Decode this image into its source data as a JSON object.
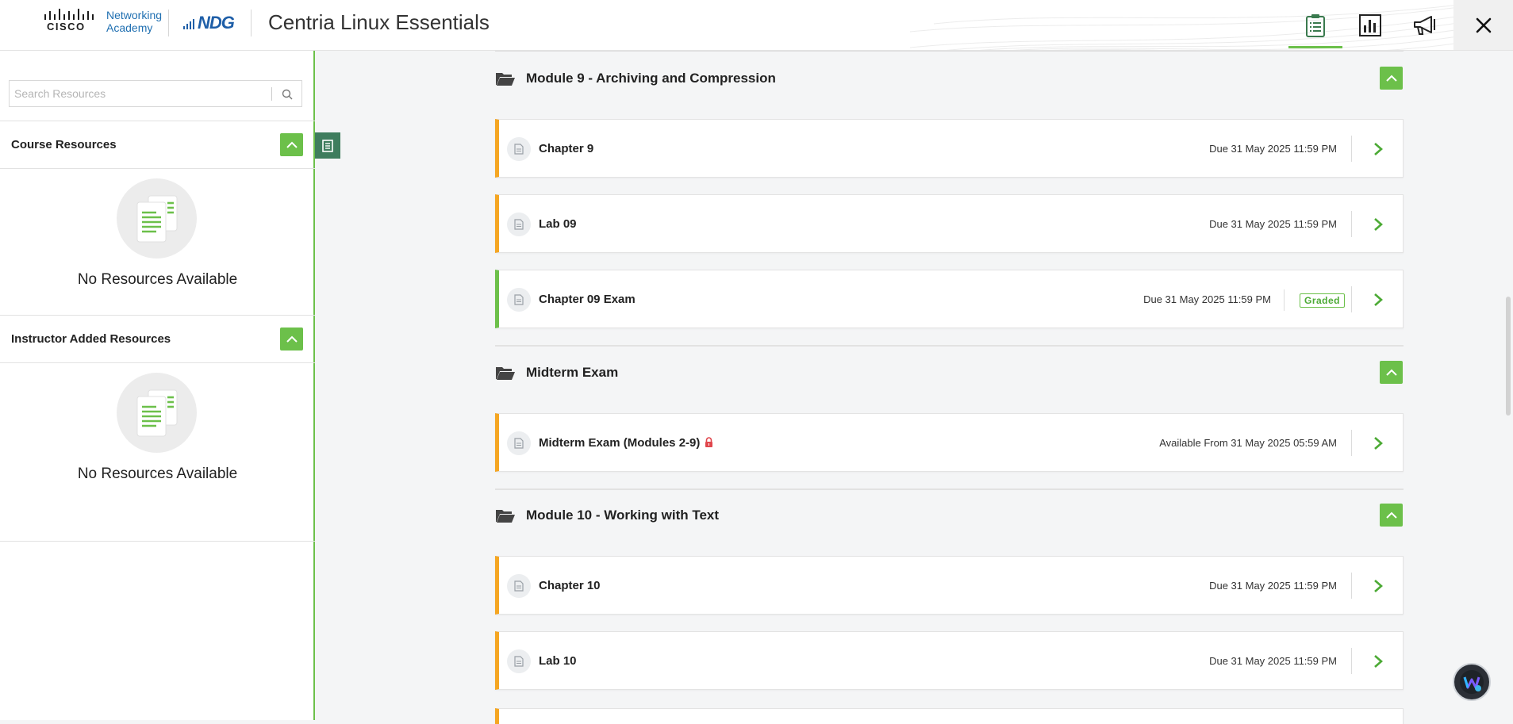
{
  "header": {
    "cisco_wordmark": "CISCO",
    "networking_academy": [
      "Networking",
      "Academy"
    ],
    "ndg_logo": "NDG",
    "app_title": "Centria Linux Essentials",
    "icons": [
      "clipboard-list-icon",
      "bar-chart-icon",
      "megaphone-icon",
      "close-icon"
    ],
    "accent_color": "#6cc04a"
  },
  "sidebar": {
    "search": {
      "placeholder": "Search Resources",
      "value": ""
    },
    "sections": [
      {
        "title": "Course Resources",
        "empty_text": "No Resources Available"
      },
      {
        "title": "Instructor Added Resources",
        "empty_text": "No Resources Available"
      }
    ]
  },
  "modules": [
    {
      "title": "Module 9 - Archiving and Compression",
      "items": [
        {
          "title": "Chapter 9",
          "due": "Due 31 May 2025 11:59 PM",
          "status_color": "#f5a623"
        },
        {
          "title": "Lab 09",
          "due": "Due 31 May 2025 11:59 PM",
          "status_color": "#f5a623"
        },
        {
          "title": "Chapter 09 Exam",
          "due": "Due 31 May 2025 11:59 PM",
          "badge": "Graded",
          "status_color": "#6cc04a"
        }
      ]
    },
    {
      "title": "Midterm Exam",
      "items": [
        {
          "title": "Midterm Exam (Modules 2-9)",
          "due": "Available From 31 May 2025 05:59 AM",
          "locked": true,
          "status_color": "#f5a623"
        }
      ]
    },
    {
      "title": "Module 10 - Working with Text",
      "items": [
        {
          "title": "Chapter 10",
          "due": "Due 31 May 2025 11:59 PM",
          "status_color": "#f5a623"
        },
        {
          "title": "Lab 10",
          "due": "Due 31 May 2025 11:59 PM",
          "status_color": "#f5a623"
        }
      ]
    }
  ]
}
